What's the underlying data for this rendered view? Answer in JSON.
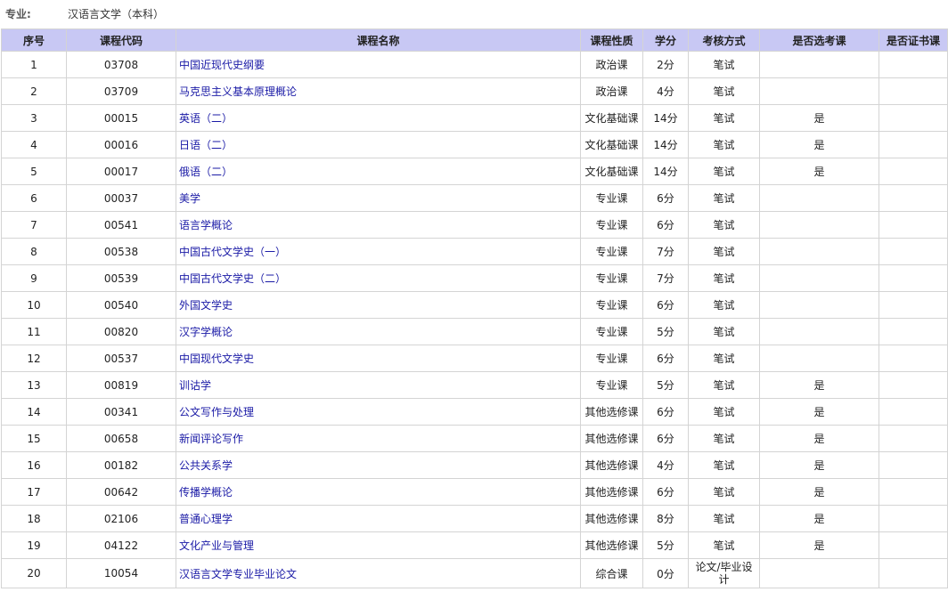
{
  "major": {
    "label": "专业:",
    "value": "汉语言文学（本科）"
  },
  "table": {
    "headers": {
      "no": "序号",
      "code": "课程代码",
      "name": "课程名称",
      "type": "课程性质",
      "credit": "学分",
      "method": "考核方式",
      "elective": "是否选考课",
      "cert": "是否证书课"
    },
    "rows": [
      {
        "no": "1",
        "code": "03708",
        "name": "中国近现代史纲要",
        "type": "政治课",
        "credit": "2分",
        "method": "笔试",
        "elective": "",
        "cert": ""
      },
      {
        "no": "2",
        "code": "03709",
        "name": "马克思主义基本原理概论",
        "type": "政治课",
        "credit": "4分",
        "method": "笔试",
        "elective": "",
        "cert": ""
      },
      {
        "no": "3",
        "code": "00015",
        "name": "英语（二）",
        "type": "文化基础课",
        "credit": "14分",
        "method": "笔试",
        "elective": "是",
        "cert": ""
      },
      {
        "no": "4",
        "code": "00016",
        "name": "日语（二）",
        "type": "文化基础课",
        "credit": "14分",
        "method": "笔试",
        "elective": "是",
        "cert": ""
      },
      {
        "no": "5",
        "code": "00017",
        "name": "俄语（二）",
        "type": "文化基础课",
        "credit": "14分",
        "method": "笔试",
        "elective": "是",
        "cert": ""
      },
      {
        "no": "6",
        "code": "00037",
        "name": "美学",
        "type": "专业课",
        "credit": "6分",
        "method": "笔试",
        "elective": "",
        "cert": ""
      },
      {
        "no": "7",
        "code": "00541",
        "name": "语言学概论",
        "type": "专业课",
        "credit": "6分",
        "method": "笔试",
        "elective": "",
        "cert": ""
      },
      {
        "no": "8",
        "code": "00538",
        "name": "中国古代文学史（一）",
        "type": "专业课",
        "credit": "7分",
        "method": "笔试",
        "elective": "",
        "cert": ""
      },
      {
        "no": "9",
        "code": "00539",
        "name": "中国古代文学史（二）",
        "type": "专业课",
        "credit": "7分",
        "method": "笔试",
        "elective": "",
        "cert": ""
      },
      {
        "no": "10",
        "code": "00540",
        "name": "外国文学史",
        "type": "专业课",
        "credit": "6分",
        "method": "笔试",
        "elective": "",
        "cert": ""
      },
      {
        "no": "11",
        "code": "00820",
        "name": "汉字学概论",
        "type": "专业课",
        "credit": "5分",
        "method": "笔试",
        "elective": "",
        "cert": ""
      },
      {
        "no": "12",
        "code": "00537",
        "name": "中国现代文学史",
        "type": "专业课",
        "credit": "6分",
        "method": "笔试",
        "elective": "",
        "cert": ""
      },
      {
        "no": "13",
        "code": "00819",
        "name": "训诂学",
        "type": "专业课",
        "credit": "5分",
        "method": "笔试",
        "elective": "是",
        "cert": ""
      },
      {
        "no": "14",
        "code": "00341",
        "name": "公文写作与处理",
        "type": "其他选修课",
        "credit": "6分",
        "method": "笔试",
        "elective": "是",
        "cert": ""
      },
      {
        "no": "15",
        "code": "00658",
        "name": "新闻评论写作",
        "type": "其他选修课",
        "credit": "6分",
        "method": "笔试",
        "elective": "是",
        "cert": ""
      },
      {
        "no": "16",
        "code": "00182",
        "name": "公共关系学",
        "type": "其他选修课",
        "credit": "4分",
        "method": "笔试",
        "elective": "是",
        "cert": ""
      },
      {
        "no": "17",
        "code": "00642",
        "name": "传播学概论",
        "type": "其他选修课",
        "credit": "6分",
        "method": "笔试",
        "elective": "是",
        "cert": ""
      },
      {
        "no": "18",
        "code": "02106",
        "name": "普通心理学",
        "type": "其他选修课",
        "credit": "8分",
        "method": "笔试",
        "elective": "是",
        "cert": ""
      },
      {
        "no": "19",
        "code": "04122",
        "name": "文化产业与管理",
        "type": "其他选修课",
        "credit": "5分",
        "method": "笔试",
        "elective": "是",
        "cert": ""
      },
      {
        "no": "20",
        "code": "10054",
        "name": "汉语言文学专业毕业论文",
        "type": "综合课",
        "credit": "0分",
        "method": "论文/毕业设计",
        "elective": "",
        "cert": ""
      }
    ]
  },
  "colors": {
    "header_bg": "#c8c8f4",
    "link": "#1a1aa6",
    "border": "#d4d4d4"
  }
}
